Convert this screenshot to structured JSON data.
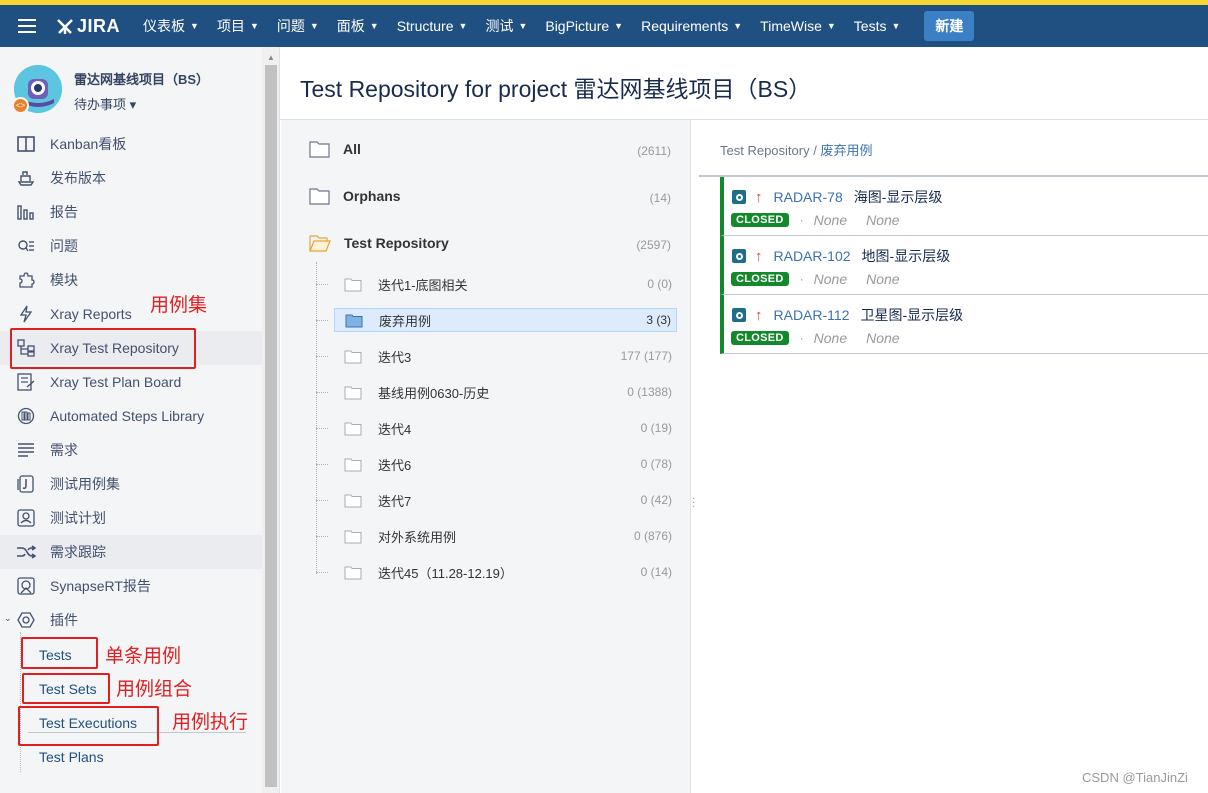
{
  "topnav": {
    "logo_text": "JIRA",
    "items": [
      {
        "label": "仪表板"
      },
      {
        "label": "项目"
      },
      {
        "label": "问题"
      },
      {
        "label": "面板"
      },
      {
        "label": "Structure"
      },
      {
        "label": "测试"
      },
      {
        "label": "BigPicture"
      },
      {
        "label": "Requirements"
      },
      {
        "label": "TimeWise"
      },
      {
        "label": "Tests"
      }
    ],
    "create_label": "新建",
    "bar_color": "#205081",
    "accent_stripe": "#f5d833"
  },
  "project": {
    "name": "雷达网基线项目（BS）",
    "board_selector": "待办事项 ▾"
  },
  "sidebar": {
    "items": [
      {
        "label": "Kanban看板",
        "icon": "board-icon"
      },
      {
        "label": "发布版本",
        "icon": "ship-icon"
      },
      {
        "label": "报告",
        "icon": "chart-icon"
      },
      {
        "label": "问题",
        "icon": "issues-icon"
      },
      {
        "label": "模块",
        "icon": "puzzle-icon"
      },
      {
        "label": "Xray Reports",
        "icon": "bolt-icon"
      },
      {
        "label": "Xray Test Repository",
        "icon": "repository-icon"
      },
      {
        "label": "Xray Test Plan Board",
        "icon": "plan-board-icon"
      },
      {
        "label": "Automated Steps Library",
        "icon": "library-icon"
      },
      {
        "label": "需求",
        "icon": "lines-icon"
      },
      {
        "label": "测试用例集",
        "icon": "testset-icon"
      },
      {
        "label": "测试计划",
        "icon": "testplan-icon"
      },
      {
        "label": "需求跟踪",
        "icon": "shuffle-icon"
      },
      {
        "label": "SynapseRT报告",
        "icon": "image-icon"
      },
      {
        "label": "插件",
        "icon": "hexagon-icon"
      }
    ],
    "plugin_children": [
      {
        "label": "Tests"
      },
      {
        "label": "Test Sets"
      },
      {
        "label": "Test Executions"
      },
      {
        "label": "Test Plans"
      }
    ]
  },
  "annotations": {
    "test_repository": "用例集",
    "tests": "单条用例",
    "test_sets": "用例组合",
    "test_executions": "用例执行"
  },
  "page": {
    "title": "Test Repository for project 雷达网基线项目（BS）"
  },
  "tree": {
    "top": [
      {
        "name": "All",
        "count": "(2611)"
      },
      {
        "name": "Orphans",
        "count": "(14)"
      },
      {
        "name": "Test Repository",
        "count": "(2597)"
      }
    ],
    "children": [
      {
        "name": "迭代1-底图相关",
        "count": "0 (0)"
      },
      {
        "name": "废弃用例",
        "count": "3 (3)"
      },
      {
        "name": "迭代3",
        "count": "177 (177)"
      },
      {
        "name": "基线用例0630-历史",
        "count": "0 (1388)"
      },
      {
        "name": "迭代4",
        "count": "0 (19)"
      },
      {
        "name": "迭代6",
        "count": "0 (78)"
      },
      {
        "name": "迭代7",
        "count": "0 (42)"
      },
      {
        "name": "对外系统用例",
        "count": "0 (876)"
      },
      {
        "name": "迭代45（11.28-12.19）",
        "count": "0 (14)"
      }
    ]
  },
  "breadcrumb": {
    "root": "Test Repository",
    "sep": " / ",
    "current": "废弃用例"
  },
  "issues": [
    {
      "key": "RADAR-78",
      "summary": "海图-显示层级",
      "status": "CLOSED",
      "field1": "None",
      "field2": "None"
    },
    {
      "key": "RADAR-102",
      "summary": "地图-显示层级",
      "status": "CLOSED",
      "field1": "None",
      "field2": "None"
    },
    {
      "key": "RADAR-112",
      "summary": "卫星图-显示层级",
      "status": "CLOSED",
      "field1": "None",
      "field2": "None"
    }
  ],
  "watermark": "CSDN @TianJinZi"
}
